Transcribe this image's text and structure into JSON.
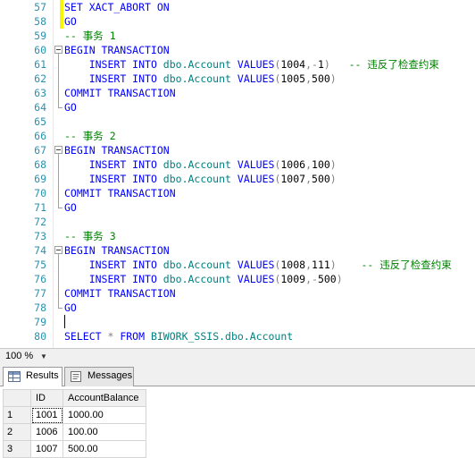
{
  "editor": {
    "lines": [
      {
        "n": "57",
        "segs": [
          [
            "kw",
            "SET XACT_ABORT ON"
          ]
        ]
      },
      {
        "n": "58",
        "segs": [
          [
            "kw",
            "GO"
          ]
        ]
      },
      {
        "n": "59",
        "segs": [
          [
            "cmt",
            "-- 事务 1"
          ]
        ]
      },
      {
        "n": "60",
        "segs": [
          [
            "kw",
            "BEGIN TRANSACTION"
          ]
        ]
      },
      {
        "n": "61",
        "segs": [
          [
            "pl",
            "    "
          ],
          [
            "kw",
            "INSERT INTO "
          ],
          [
            "obj",
            "dbo.Account "
          ],
          [
            "kw",
            "VALUES"
          ],
          [
            "op",
            "("
          ],
          [
            "num",
            "1004"
          ],
          [
            "op",
            ","
          ],
          [
            "op",
            "-"
          ],
          [
            "num",
            "1"
          ],
          [
            "op",
            ")"
          ],
          [
            "pl",
            "   "
          ],
          [
            "cmt",
            "-- 违反了检查约束"
          ]
        ]
      },
      {
        "n": "62",
        "segs": [
          [
            "pl",
            "    "
          ],
          [
            "kw",
            "INSERT INTO "
          ],
          [
            "obj",
            "dbo.Account "
          ],
          [
            "kw",
            "VALUES"
          ],
          [
            "op",
            "("
          ],
          [
            "num",
            "1005"
          ],
          [
            "op",
            ","
          ],
          [
            "num",
            "500"
          ],
          [
            "op",
            ")"
          ]
        ]
      },
      {
        "n": "63",
        "segs": [
          [
            "kw",
            "COMMIT TRANSACTION"
          ]
        ]
      },
      {
        "n": "64",
        "segs": [
          [
            "kw",
            "GO"
          ]
        ]
      },
      {
        "n": "65",
        "segs": []
      },
      {
        "n": "66",
        "segs": [
          [
            "cmt",
            "-- 事务 2"
          ]
        ]
      },
      {
        "n": "67",
        "segs": [
          [
            "kw",
            "BEGIN TRANSACTION"
          ]
        ]
      },
      {
        "n": "68",
        "segs": [
          [
            "pl",
            "    "
          ],
          [
            "kw",
            "INSERT INTO "
          ],
          [
            "obj",
            "dbo.Account "
          ],
          [
            "kw",
            "VALUES"
          ],
          [
            "op",
            "("
          ],
          [
            "num",
            "1006"
          ],
          [
            "op",
            ","
          ],
          [
            "num",
            "100"
          ],
          [
            "op",
            ")"
          ]
        ]
      },
      {
        "n": "69",
        "segs": [
          [
            "pl",
            "    "
          ],
          [
            "kw",
            "INSERT INTO "
          ],
          [
            "obj",
            "dbo.Account "
          ],
          [
            "kw",
            "VALUES"
          ],
          [
            "op",
            "("
          ],
          [
            "num",
            "1007"
          ],
          [
            "op",
            ","
          ],
          [
            "num",
            "500"
          ],
          [
            "op",
            ")"
          ]
        ]
      },
      {
        "n": "70",
        "segs": [
          [
            "kw",
            "COMMIT TRANSACTION"
          ]
        ]
      },
      {
        "n": "71",
        "segs": [
          [
            "kw",
            "GO"
          ]
        ]
      },
      {
        "n": "72",
        "segs": []
      },
      {
        "n": "73",
        "segs": [
          [
            "cmt",
            "-- 事务 3"
          ]
        ]
      },
      {
        "n": "74",
        "segs": [
          [
            "kw",
            "BEGIN TRANSACTION"
          ]
        ]
      },
      {
        "n": "75",
        "segs": [
          [
            "pl",
            "    "
          ],
          [
            "kw",
            "INSERT INTO "
          ],
          [
            "obj",
            "dbo.Account "
          ],
          [
            "kw",
            "VALUES"
          ],
          [
            "op",
            "("
          ],
          [
            "num",
            "1008"
          ],
          [
            "op",
            ","
          ],
          [
            "num",
            "111"
          ],
          [
            "op",
            ")"
          ],
          [
            "pl",
            "    "
          ],
          [
            "cmt",
            "-- 违反了检查约束"
          ]
        ]
      },
      {
        "n": "76",
        "segs": [
          [
            "pl",
            "    "
          ],
          [
            "kw",
            "INSERT INTO "
          ],
          [
            "obj",
            "dbo.Account "
          ],
          [
            "kw",
            "VALUES"
          ],
          [
            "op",
            "("
          ],
          [
            "num",
            "1009"
          ],
          [
            "op",
            ","
          ],
          [
            "op",
            "-"
          ],
          [
            "num",
            "500"
          ],
          [
            "op",
            ")"
          ]
        ]
      },
      {
        "n": "77",
        "segs": [
          [
            "kw",
            "COMMIT TRANSACTION"
          ]
        ]
      },
      {
        "n": "78",
        "segs": [
          [
            "kw",
            "GO"
          ]
        ]
      },
      {
        "n": "79",
        "segs": []
      },
      {
        "n": "80",
        "segs": [
          [
            "kw",
            "SELECT "
          ],
          [
            "op",
            "* "
          ],
          [
            "kw",
            "FROM "
          ],
          [
            "obj",
            "BIWORK_SSIS.dbo.Account"
          ]
        ]
      }
    ],
    "colors": {
      "keyword": "#0000ff",
      "object": "#008080",
      "comment": "#008000",
      "operator": "#808080",
      "line_number": "#2b91af",
      "change_mark": "#f7f700"
    }
  },
  "zoom": {
    "value": "100 %",
    "dropdown_icon": "chevron-down-icon"
  },
  "results": {
    "tabs": [
      {
        "label": "Results",
        "icon": "grid-icon",
        "active": true
      },
      {
        "label": "Messages",
        "icon": "messages-icon",
        "active": false
      }
    ],
    "columns": [
      "ID",
      "AccountBalance"
    ],
    "rows": [
      {
        "n": "1",
        "id": "1001",
        "balance": "1000.00"
      },
      {
        "n": "2",
        "id": "1006",
        "balance": "100.00"
      },
      {
        "n": "3",
        "id": "1007",
        "balance": "500.00"
      }
    ]
  }
}
